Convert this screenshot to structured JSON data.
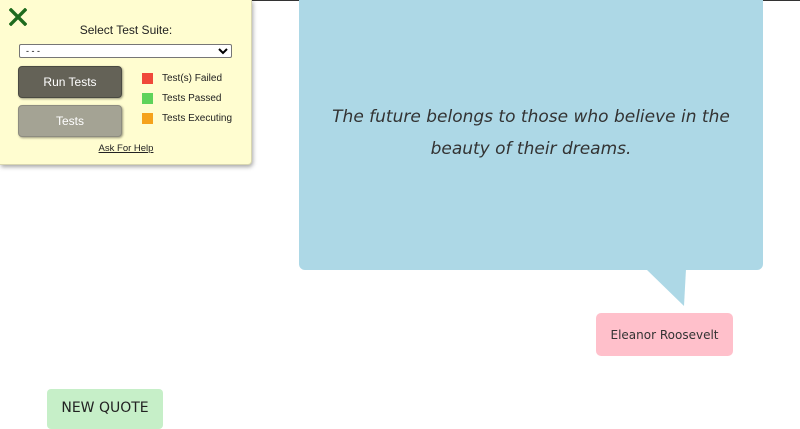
{
  "test_panel": {
    "title": "Select Test Suite:",
    "suite_select": {
      "selected": "- - -",
      "options": [
        "- - -"
      ]
    },
    "run_tests_label": "Run Tests",
    "tests_label": "Tests",
    "legend": [
      {
        "label": "Test(s) Failed",
        "color": "#f0483a"
      },
      {
        "label": "Tests Passed",
        "color": "#5fd35a"
      },
      {
        "label": "Tests Executing",
        "color": "#f5a21c"
      }
    ],
    "help_link": "Ask For Help",
    "close_icon": "close-x-icon",
    "close_color": "#1e6b1e"
  },
  "quote": {
    "text": "The future belongs to those who believe in the beauty of their dreams.",
    "author": "Eleanor Roosevelt",
    "box_color": "#add8e6",
    "author_color": "#ffc0cb"
  },
  "new_quote_button": {
    "label": "NEW QUOTE",
    "color": "#c6efc8"
  }
}
